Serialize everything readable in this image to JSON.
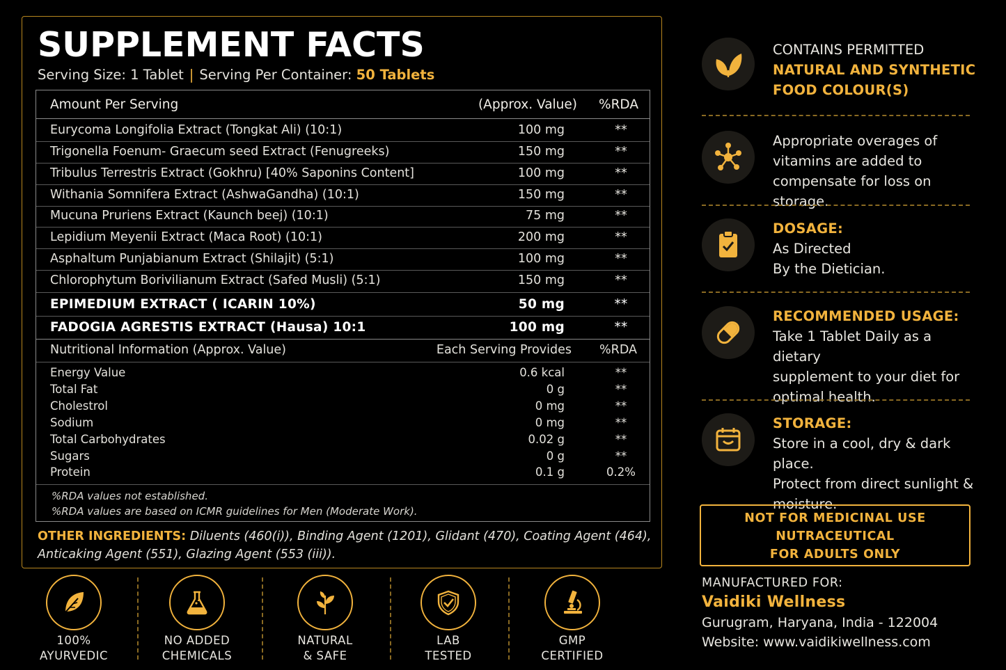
{
  "supplement_facts": {
    "title": "SUPPLEMENT FACTS",
    "serving_size": "Serving Size: 1 Tablet",
    "separator": "|",
    "serving_per_container_label": "Serving Per Container:",
    "serving_per_container_value": "50 Tablets",
    "header": {
      "amount": "Amount Per Serving",
      "approx": "(Approx. Value)",
      "rda": "%RDA"
    },
    "ingredients": [
      {
        "name": "Eurycoma Longifolia Extract (Tongkat Ali) (10:1)",
        "value": "100 mg",
        "rda": "**"
      },
      {
        "name": "Trigonella Foenum- Graecum seed Extract (Fenugreeks)",
        "value": "150 mg",
        "rda": "**"
      },
      {
        "name": "Tribulus Terrestris Extract (Gokhru) [40% Saponins Content]",
        "value": "100 mg",
        "rda": "**"
      },
      {
        "name": "Withania Somnifera Extract (AshwaGandha) (10:1)",
        "value": "150 mg",
        "rda": "**"
      },
      {
        "name": "Mucuna Pruriens Extract (Kaunch beej) (10:1)",
        "value": "75 mg",
        "rda": "**"
      },
      {
        "name": "Lepidium Meyenii Extract (Maca Root) (10:1)",
        "value": "200 mg",
        "rda": "**"
      },
      {
        "name": "Asphaltum Punjabianum Extract (Shilajit) (5:1)",
        "value": "100 mg",
        "rda": "**"
      },
      {
        "name": "Chlorophytum Borivilianum Extract (Safed Musli) (5:1)",
        "value": "150 mg",
        "rda": "**"
      }
    ],
    "highlighted": [
      {
        "name": "EPIMEDIUM EXTRACT ( ICARIN 10%)",
        "value": "50 mg",
        "rda": "**"
      },
      {
        "name": "FADOGIA AGRESTIS EXTRACT (Hausa) 10:1",
        "value": "100 mg",
        "rda": "**"
      }
    ],
    "nutrition_header": {
      "label": "Nutritional Information (Approx. Value)",
      "provides": "Each Serving Provides",
      "rda": "%RDA"
    },
    "nutrition": [
      {
        "name": "Energy Value",
        "value": "0.6 kcal",
        "rda": "**"
      },
      {
        "name": "Total Fat",
        "value": "0 g",
        "rda": "**"
      },
      {
        "name": "Cholestrol",
        "value": "0 mg",
        "rda": "**"
      },
      {
        "name": "Sodium",
        "value": "0 mg",
        "rda": "**"
      },
      {
        "name": "Total Carbohydrates",
        "value": "0.02 g",
        "rda": "**"
      },
      {
        "name": "Sugars",
        "value": "0 g",
        "rda": "**"
      },
      {
        "name": "Protein",
        "value": "0.1 g",
        "rda": "0.2%"
      }
    ],
    "footnotes": [
      "%RDA values not established.",
      "%RDA values are based on ICMR guidelines for Men (Moderate Work)."
    ],
    "other_ingredients_label": "OTHER INGREDIENTS:",
    "other_ingredients_line1": "Diluents (460(i)), Binding Agent (1201), Glidant (470), Coating Agent (464),",
    "other_ingredients_line2": "Anticaking Agent (551), Glazing Agent (553 (iii))."
  },
  "badges": [
    {
      "icon": "leaf-icon",
      "line1": "100%",
      "line2": "AYURVEDIC"
    },
    {
      "icon": "flask-icon",
      "line1": "NO ADDED",
      "line2": "CHEMICALS"
    },
    {
      "icon": "herb-icon",
      "line1": "NATURAL",
      "line2": "& SAFE"
    },
    {
      "icon": "shield-check-icon",
      "line1": "LAB",
      "line2": "TESTED"
    },
    {
      "icon": "microscope-icon",
      "line1": "GMP",
      "line2": "CERTIFIED"
    }
  ],
  "info": {
    "colours": {
      "line1": "CONTAINS PERMITTED",
      "line2": "NATURAL AND SYNTHETIC",
      "line3": "FOOD COLOUR(S)"
    },
    "overages": {
      "line1": "Appropriate overages of",
      "line2": "vitamins are added to",
      "line3": "compensate for loss on storage."
    },
    "dosage": {
      "title": "DOSAGE:",
      "line1": "As Directed",
      "line2": "By the Dietician."
    },
    "usage": {
      "title": "RECOMMENDED USAGE:",
      "line1": "Take 1 Tablet Daily as a dietary",
      "line2": "supplement to your diet for",
      "line3": "optimal health."
    },
    "storage": {
      "title": "STORAGE:",
      "line1": "Store in a cool, dry & dark place.",
      "line2": "Protect from direct sunlight &",
      "line3": "moisture."
    }
  },
  "warning": {
    "line1": "NOT FOR MEDICINAL USE",
    "line2": "NUTRACEUTICAL",
    "line3": "FOR ADULTS ONLY"
  },
  "manufacturer": {
    "label": "MANUFACTURED FOR:",
    "company": "Vaidiki Wellness",
    "address": "Gurugram, Haryana, India - 122004",
    "website": "Website: www.vaidikiwellness.com"
  },
  "colors": {
    "accent": "#f2b33d",
    "background": "#000000",
    "text": "#e8e6e0"
  }
}
